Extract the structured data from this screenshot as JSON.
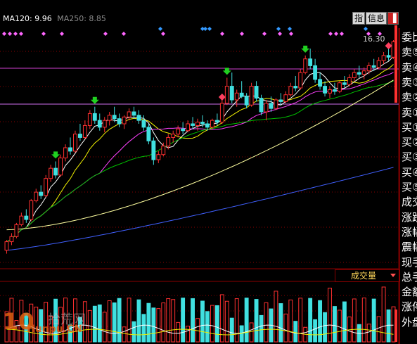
{
  "legend": {
    "ma120": "MA120: 9.96",
    "ma250": "MA250: 8.85"
  },
  "toolbar": {
    "btn_zhi": "指",
    "btn_info": "信息",
    "btn_close": "▐"
  },
  "price_tag": "16.30",
  "volume_panel": {
    "selector_label": "成交量"
  },
  "side_panel": {
    "rows": [
      "委比",
      "卖⑤",
      "卖④",
      "卖③",
      "卖②",
      "卖①",
      "买①",
      "买②",
      "买③",
      "买④",
      "买⑤",
      "成交",
      "涨跌",
      "涨幅",
      "震幅",
      "现手",
      "总手",
      "金额",
      "涨停",
      "外盘"
    ]
  },
  "watermark": {
    "num": "10",
    "cn": "拾荒网",
    "url": "Hunpu.CN"
  },
  "colors": {
    "up": "#ff3030",
    "down": "#40e0e0",
    "ma5": "#ffffff",
    "ma10": "#f0f000",
    "ma20": "#ff40ff",
    "ma60": "#00c000",
    "ma120": "#ffffa0",
    "ma250": "#4060ff",
    "hline_upper": "#d040d0",
    "hline_lower": "#d070f0",
    "grid": "#8b0000"
  },
  "chart_data": {
    "type": "candlestick",
    "indicators": [
      "MA120",
      "MA250"
    ],
    "ma120_last": 9.96,
    "ma250_last": 8.85,
    "last_price_label": 16.3,
    "candles": [
      [
        4.0,
        4.6,
        3.8,
        4.5
      ],
      [
        4.5,
        5.0,
        4.3,
        4.8
      ],
      [
        4.8,
        5.6,
        4.7,
        5.5
      ],
      [
        5.5,
        6.2,
        5.4,
        6.0
      ],
      [
        6.0,
        6.4,
        5.6,
        5.8
      ],
      [
        5.8,
        7.0,
        5.7,
        6.9
      ],
      [
        6.9,
        7.6,
        6.8,
        7.4
      ],
      [
        7.4,
        7.8,
        7.0,
        7.2
      ],
      [
        7.2,
        8.4,
        7.1,
        8.2
      ],
      [
        8.2,
        9.0,
        8.0,
        8.8
      ],
      [
        8.8,
        9.2,
        8.2,
        8.4
      ],
      [
        8.4,
        9.6,
        8.3,
        9.4
      ],
      [
        9.4,
        10.2,
        9.2,
        10.0
      ],
      [
        10.0,
        10.6,
        9.6,
        9.8
      ],
      [
        9.8,
        11.0,
        9.7,
        10.8
      ],
      [
        10.8,
        11.4,
        10.4,
        10.6
      ],
      [
        10.6,
        11.6,
        10.5,
        11.3
      ],
      [
        11.3,
        12.2,
        11.1,
        12.0
      ],
      [
        12.0,
        12.4,
        11.4,
        11.6
      ],
      [
        11.6,
        12.0,
        11.0,
        11.2
      ],
      [
        11.2,
        11.8,
        10.9,
        11.6
      ],
      [
        11.6,
        12.1,
        11.3,
        11.9
      ],
      [
        11.9,
        12.4,
        11.5,
        11.7
      ],
      [
        11.7,
        12.0,
        11.2,
        11.4
      ],
      [
        11.4,
        11.9,
        11.1,
        11.8
      ],
      [
        11.8,
        12.3,
        11.6,
        12.1
      ],
      [
        12.1,
        12.4,
        11.7,
        11.9
      ],
      [
        11.9,
        12.2,
        11.4,
        11.6
      ],
      [
        11.6,
        11.9,
        11.0,
        11.2
      ],
      [
        11.2,
        11.4,
        10.2,
        10.4
      ],
      [
        10.4,
        10.6,
        9.0,
        9.3
      ],
      [
        9.3,
        9.8,
        9.1,
        9.6
      ],
      [
        9.6,
        10.3,
        9.5,
        10.1
      ],
      [
        10.1,
        10.8,
        9.9,
        10.6
      ],
      [
        10.6,
        11.0,
        10.3,
        10.8
      ],
      [
        10.8,
        11.3,
        10.6,
        11.1
      ],
      [
        11.1,
        11.5,
        10.8,
        11.0
      ],
      [
        11.0,
        11.6,
        10.9,
        11.4
      ],
      [
        11.4,
        11.8,
        11.1,
        11.3
      ],
      [
        11.3,
        11.7,
        11.0,
        11.5
      ],
      [
        11.5,
        11.9,
        11.2,
        11.4
      ],
      [
        11.4,
        11.6,
        11.0,
        11.2
      ],
      [
        11.2,
        11.7,
        11.1,
        11.6
      ],
      [
        11.6,
        12.0,
        11.3,
        11.5
      ],
      [
        11.5,
        12.8,
        11.4,
        12.6
      ],
      [
        12.6,
        14.1,
        12.5,
        13.6
      ],
      [
        13.6,
        14.4,
        12.6,
        12.8
      ],
      [
        12.8,
        13.4,
        12.4,
        13.2
      ],
      [
        13.2,
        13.9,
        12.9,
        13.0
      ],
      [
        13.0,
        13.2,
        12.3,
        12.5
      ],
      [
        12.5,
        13.8,
        12.4,
        13.6
      ],
      [
        13.6,
        13.9,
        12.7,
        12.9
      ],
      [
        12.9,
        13.1,
        11.9,
        12.1
      ],
      [
        12.1,
        12.8,
        11.6,
        12.6
      ],
      [
        12.6,
        13.0,
        12.1,
        12.3
      ],
      [
        12.3,
        12.9,
        12.2,
        12.8
      ],
      [
        12.8,
        13.2,
        12.5,
        12.7
      ],
      [
        12.7,
        13.3,
        12.6,
        13.1
      ],
      [
        13.1,
        13.8,
        13.0,
        13.6
      ],
      [
        13.6,
        14.2,
        13.3,
        13.5
      ],
      [
        13.5,
        14.6,
        13.4,
        14.4
      ],
      [
        14.4,
        15.4,
        14.3,
        15.2
      ],
      [
        15.2,
        15.8,
        14.6,
        14.8
      ],
      [
        14.8,
        15.2,
        13.8,
        14.0
      ],
      [
        14.0,
        14.4,
        13.4,
        13.6
      ],
      [
        13.6,
        13.9,
        13.0,
        13.2
      ],
      [
        13.2,
        13.6,
        12.9,
        13.4
      ],
      [
        13.4,
        13.8,
        13.1,
        13.3
      ],
      [
        13.3,
        13.9,
        13.2,
        13.8
      ],
      [
        13.8,
        14.2,
        13.5,
        13.7
      ],
      [
        13.7,
        14.3,
        13.6,
        14.1
      ],
      [
        14.1,
        14.6,
        13.9,
        14.4
      ],
      [
        14.4,
        14.8,
        14.1,
        14.3
      ],
      [
        14.3,
        14.7,
        14.0,
        14.5
      ],
      [
        14.5,
        15.0,
        14.3,
        14.8
      ],
      [
        14.8,
        15.2,
        14.5,
        14.7
      ],
      [
        14.7,
        15.3,
        14.6,
        15.1
      ],
      [
        15.1,
        15.6,
        14.9,
        15.4
      ],
      [
        15.4,
        15.8,
        15.1,
        15.3
      ],
      [
        15.3,
        16.3,
        15.2,
        16.2
      ]
    ]
  }
}
